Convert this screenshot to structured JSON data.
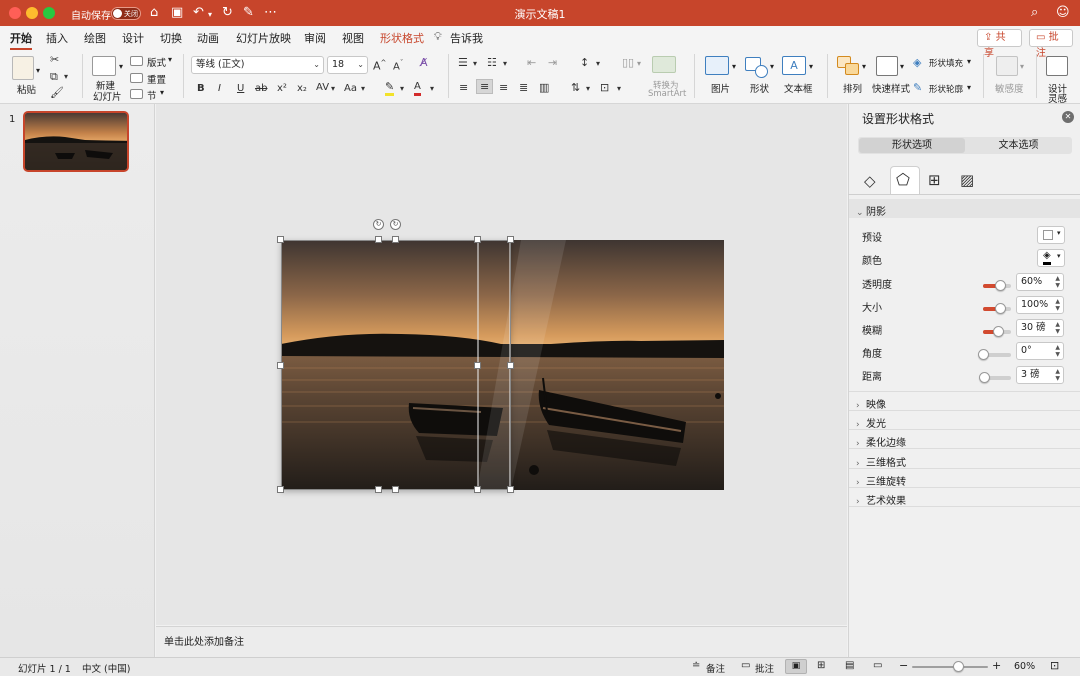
{
  "colors": {
    "accent": "#c7452b",
    "slider_fill": "#d24a2f"
  },
  "titlebar": {
    "autosave_label": "自动保存",
    "toggle_label": "关闭",
    "doc_title": "演示文稿1",
    "icons": [
      "home-icon",
      "save-icon",
      "undo-icon",
      "redo-icon",
      "edit-icon",
      "more-icon"
    ]
  },
  "ribbon": {
    "tabs": [
      "开始",
      "插入",
      "绘图",
      "设计",
      "切换",
      "动画",
      "幻灯片放映",
      "审阅",
      "视图",
      "形状格式"
    ],
    "tell_me": "告诉我",
    "share_label": "共享",
    "comments_label": "批注",
    "clipboard": {
      "paste": "粘贴"
    },
    "slides": {
      "new_slide_l1": "新建",
      "new_slide_l2": "幻灯片",
      "layout": "版式",
      "reset": "重置",
      "section": "节"
    },
    "font": {
      "family": "等线 (正文)",
      "size": "18",
      "bold": "B",
      "italic": "I",
      "underline": "U",
      "strike": "ab",
      "superscript": "x²",
      "subscript": "x₂",
      "spacing": "AV",
      "case": "Aa"
    },
    "paragraph": {
      "smartart_l1": "转换为",
      "smartart_l2": "SmartArt"
    },
    "insert": {
      "picture": "图片",
      "shape": "形状",
      "textbox": "文本框"
    },
    "drawing": {
      "arrange": "排列",
      "quick_styles": "快速样式",
      "shape_fill": "形状填充",
      "shape_outline": "形状轮廓"
    },
    "sensitivity": "敏感度",
    "designer_l1": "设计",
    "designer_l2": "灵感"
  },
  "thumbnails": {
    "slide_number": "1"
  },
  "notes": {
    "placeholder": "单击此处添加备注"
  },
  "panel": {
    "title": "设置形状格式",
    "tabs": [
      "形状选项",
      "文本选项"
    ],
    "icon_tabs": [
      "fill-line-icon",
      "effects-icon",
      "size-properties-icon",
      "picture-icon"
    ],
    "shadow": {
      "header": "阴影",
      "preset_label": "预设",
      "color_label": "颜色",
      "rows": [
        {
          "label": "透明度",
          "value": "60%",
          "level": 0.6
        },
        {
          "label": "大小",
          "value": "100%",
          "level": 0.6
        },
        {
          "label": "模糊",
          "value": "30 磅",
          "level": 0.55
        },
        {
          "label": "角度",
          "value": "0°",
          "level": 0
        },
        {
          "label": "距离",
          "value": "3 磅",
          "level": 0.05
        }
      ]
    },
    "sections": [
      "映像",
      "发光",
      "柔化边缘",
      "三维格式",
      "三维旋转",
      "艺术效果"
    ]
  },
  "status": {
    "slide_info": "幻灯片 1 / 1",
    "language": "中文 (中国)",
    "notes": "备注",
    "comments": "批注",
    "zoom": "60%",
    "zoom_level": 0.6
  }
}
